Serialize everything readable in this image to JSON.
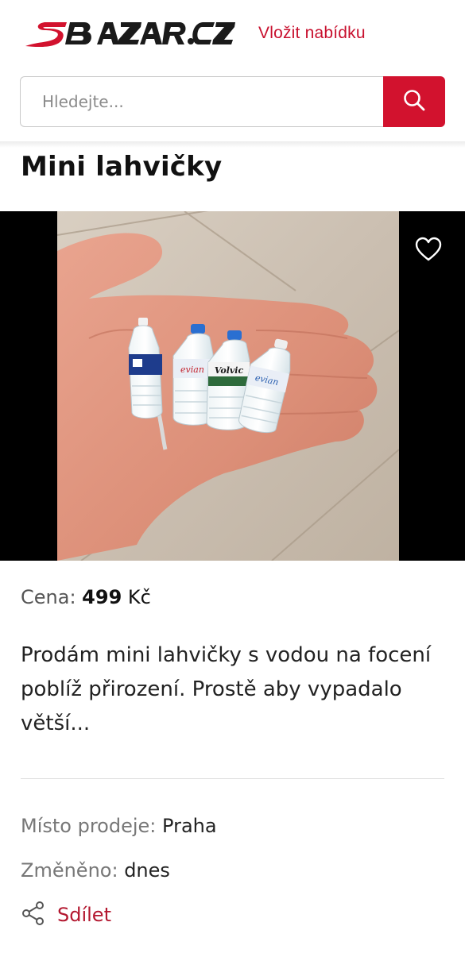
{
  "header": {
    "logo_text": "SBAZAR.CZ",
    "post_offer": "Vložit nabídku"
  },
  "search": {
    "placeholder": "Hledejte...",
    "button_icon": "search-icon"
  },
  "listing": {
    "title": "Mini lahvičky",
    "favorite_icon": "heart-icon",
    "price_label": "Cena:",
    "price_value": "499",
    "price_currency": "Kč",
    "description": "Prodám mini lahvičky s vodou na focení poblíž přirození. Prostě aby vypadalo větší...",
    "place_label": "Místo prodeje:",
    "place_value": "Praha",
    "changed_label": "Změněno:",
    "changed_value": "dnes",
    "share_label": "Sdílet",
    "share_icon": "share-icon",
    "bottle_labels": [
      "evian",
      "Volvic",
      "evian"
    ]
  },
  "colors": {
    "brand_red": "#d2122e",
    "logo_dark": "#1a1a1a"
  }
}
